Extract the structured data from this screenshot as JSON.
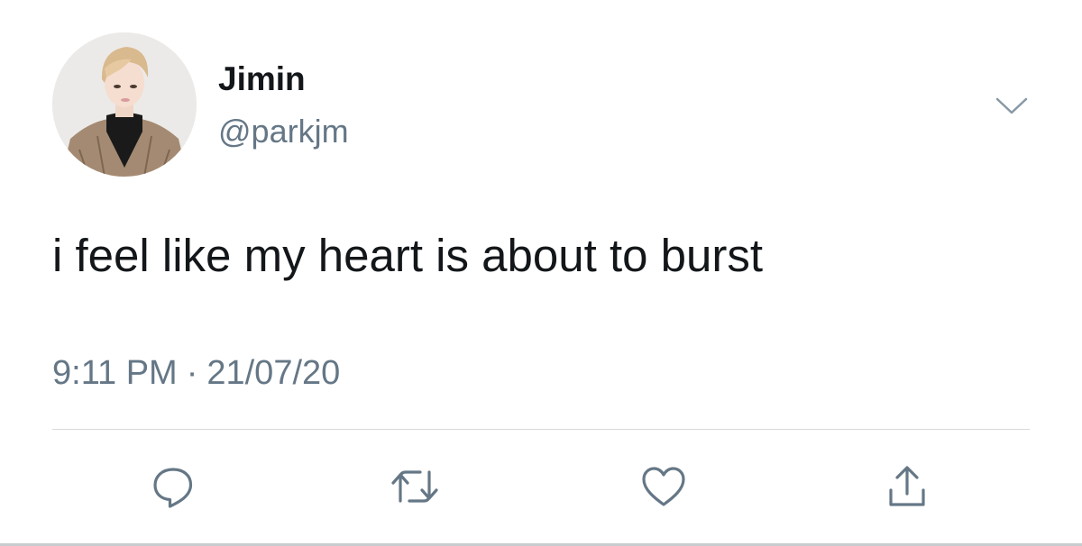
{
  "tweet": {
    "display_name": "Jimin",
    "handle": "@parkjm",
    "text": "i feel like my heart is about to burst",
    "time": "9:11 PM",
    "separator": "·",
    "date": "21/07/20"
  },
  "icons": {
    "menu": "chevron-down-icon",
    "reply": "speech-bubble-icon",
    "retweet": "retweet-arrows-icon",
    "like": "heart-icon",
    "share": "share-upload-icon"
  },
  "colors": {
    "text_primary": "#14171a",
    "text_secondary": "#657786",
    "icon": "#657786",
    "divider": "#d6d9dc"
  }
}
